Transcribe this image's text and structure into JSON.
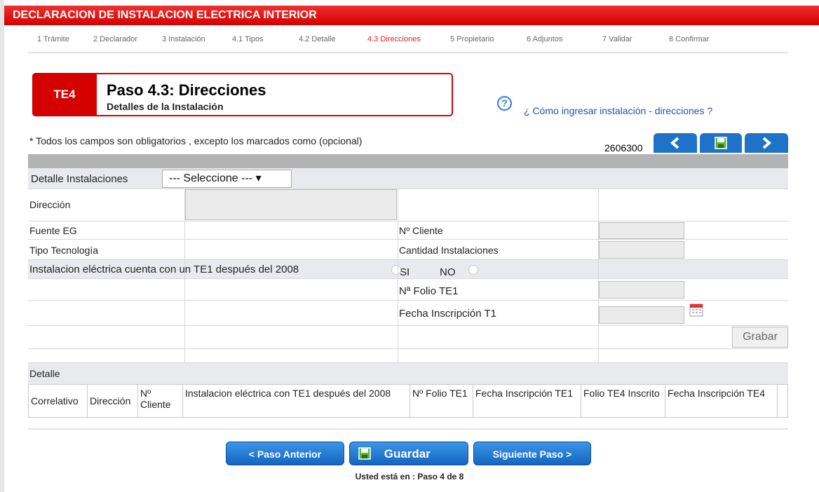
{
  "app_title": "DECLARACION DE INSTALACION ELECTRICA INTERIOR",
  "steps": [
    {
      "label": "1 Trámite"
    },
    {
      "label": "2 Declarador"
    },
    {
      "label": "3 Instalación"
    },
    {
      "label": "4.1 Tipos"
    },
    {
      "label": "4.2 Detalle"
    },
    {
      "label": "4.3 Direcciones"
    },
    {
      "label": "5 Propietario"
    },
    {
      "label": "6 Adjuntos"
    },
    {
      "label": "7 Validar"
    },
    {
      "label": "8 Confirmar"
    }
  ],
  "active_step": "4.3 Direcciones",
  "header": {
    "badge": "TE4",
    "title": "Paso 4.3: Direcciones",
    "subtitle": "Detalles de la Instalación",
    "help_icon": "question-circle-icon",
    "help_link": "¿ Cómo ingresar instalación - direcciones ?"
  },
  "required_note": "* Todos los campos son obligatorios , excepto los marcados como (opcional)",
  "record_id": "2606300",
  "form": {
    "detalle_label": "Detalle Instalaciones",
    "detalle_select": "--- Seleccione --- ▾",
    "direccion_label": "Dirección",
    "direccion_value": "",
    "fuente_label": "Fuente EG",
    "fuente_value": "",
    "tipo_label": "Tipo Tecnología",
    "tipo_value": "",
    "cliente_label": "Nº Cliente",
    "cliente_value": "",
    "cantidad_label": "Cantidad Instalaciones",
    "cantidad_value": "",
    "te1_question": "Instalacion eléctrica cuenta con un TE1 después del 2008",
    "si_label": "SI",
    "no_label": "NO",
    "folio_label": "Nª Folio TE1",
    "folio_value": "",
    "fecha_label": "Fecha Inscripción T1",
    "fecha_value": "",
    "grabar_label": "Grabar"
  },
  "detalle_section": {
    "title": "Detalle",
    "columns": [
      "Correlativo",
      "Dirección",
      "Nº Cliente",
      "Instalacion eléctrica con TE1 después del 2008",
      "Nº Folio TE1",
      "Fecha Inscripción TE1",
      "Folio TE4 Inscrito",
      "Fecha Inscripción TE4"
    ]
  },
  "buttons": {
    "prev": "< Paso Anterior",
    "save": "Guardar",
    "next": "Siguiente Paso >"
  },
  "footer": "Usted está en : Paso 4 de 8",
  "colors": {
    "brand_red": "#d40000",
    "active_step": "#e31e24",
    "button_blue": "#1e73c8",
    "row_shade": "#e9eaee",
    "input_bg": "#ebebeb"
  }
}
